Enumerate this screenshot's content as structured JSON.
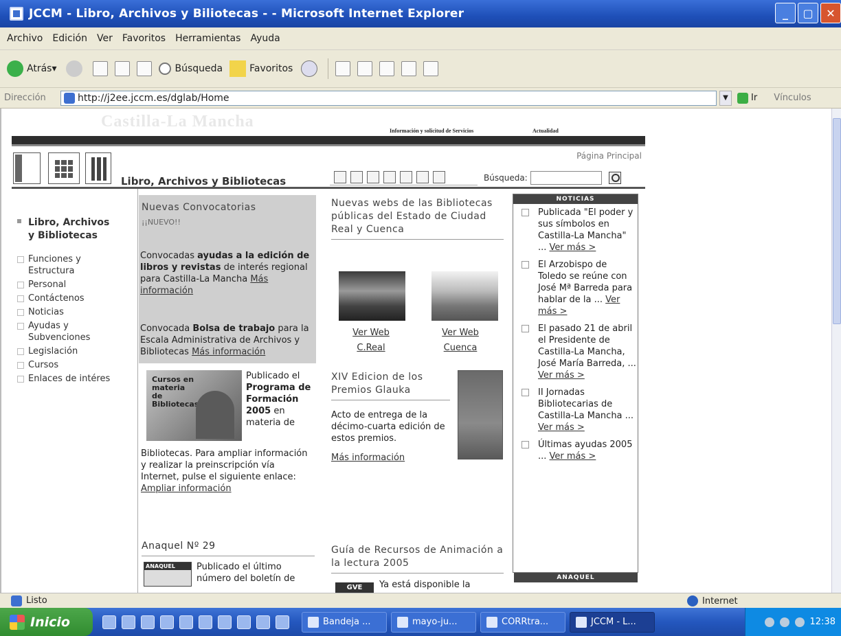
{
  "window": {
    "title": "JCCM - Libro, Archivos y Biliotecas - - Microsoft Internet Explorer"
  },
  "menu": [
    "Archivo",
    "Edición",
    "Ver",
    "Favoritos",
    "Herramientas",
    "Ayuda"
  ],
  "toolbar": {
    "back": "Atrás",
    "search": "Búsqueda",
    "favorites": "Favoritos"
  },
  "address": {
    "label": "Dirección",
    "url": "http://j2ee.jccm.es/dglab/Home",
    "go": "Ir",
    "links": "Vínculos"
  },
  "site": {
    "brand": "Castilla-La Mancha",
    "nav": [
      "Información y solicitud de Servicios",
      "Actualidad"
    ],
    "home_link": "Página Principal",
    "section_title": "Libro, Archivos y Bibliotecas",
    "search_label": "Búsqueda:"
  },
  "sidebar": {
    "heading_1": "Libro, Archivos",
    "heading_2": "y Bibliotecas",
    "items": [
      "Funciones y Estructura",
      "Personal",
      "Contáctenos",
      "Noticias",
      "Ayudas y Subvenciones",
      "Legislación",
      "Cursos",
      "Enlaces de intéres"
    ]
  },
  "nuevas": {
    "title": "Nuevas Convocatorias",
    "subtitle": "¡¡NUEVO!!",
    "p1_pre": "Convocadas ",
    "p1_bold": "ayudas a la edición de libros y revistas",
    "p1_post": " de interés regional para Castilla-La Mancha ",
    "p1_link": "Más información",
    "p2_pre": "Convocada ",
    "p2_bold": "Bolsa de trabajo",
    "p2_post": " para la Escala Administrativa de Archivos y Bibliotecas ",
    "p2_link": "Más información"
  },
  "cursos": {
    "image_caption": "Cursos en materia de Bibliotecas",
    "right_pre": "Publicado el ",
    "right_bold": "Programa de Formación 2005",
    "right_post": " en materia de",
    "bottom_text": "Bibliotecas. Para ampliar información y realizar la preinscripción vía Internet, pulse el siguiente enlace: ",
    "bottom_link": "Ampliar información"
  },
  "anaquel": {
    "title": "Anaquel Nº 29",
    "img_label": "ANAQUEL",
    "text": "Publicado el último número del boletín de"
  },
  "webs": {
    "title": "Nuevas webs de las Bibliotecas públicas del Estado de Ciudad Real y Cuenca",
    "link1_a": "Ver Web",
    "link1_b": "C.Real",
    "link2_a": "Ver Web",
    "link2_b": "Cuenca"
  },
  "premios": {
    "title": "XIV Edicion de los Premios Glauka",
    "text": "Acto de entrega de la décimo-cuarta edición de estos premios.",
    "link": "Más información"
  },
  "guia": {
    "title": "Guía de Recursos de Animación a la lectura 2005",
    "logo": "GVE",
    "text": "Ya está disponible la"
  },
  "noticias": {
    "header": "NOTICIAS",
    "items": [
      {
        "text": "Publicada \"El poder y sus símbolos en Castilla-La Mancha\" ... ",
        "link": "Ver más >"
      },
      {
        "text": "El Arzobispo de Toledo se reúne con José Mª Barreda para hablar de la ... ",
        "link": "Ver más >"
      },
      {
        "text": "El pasado 21 de abril el Presidente de Castilla-La Mancha, José María Barreda, ... ",
        "link": "Ver más >"
      },
      {
        "text": "II Jornadas Bibliotecarias de Castilla-La Mancha ... ",
        "link": "Ver más >"
      },
      {
        "text": "Últimas ayudas 2005 ... ",
        "link": "Ver más >"
      }
    ],
    "anaquel_header": "ANAQUEL"
  },
  "status": {
    "text": "Listo",
    "zone": "Internet"
  },
  "taskbar": {
    "start": "Inicio",
    "tasks": [
      "Bandeja ...",
      "mayo-ju...",
      "CORRtra...",
      "JCCM - L..."
    ],
    "clock": "12:38"
  }
}
